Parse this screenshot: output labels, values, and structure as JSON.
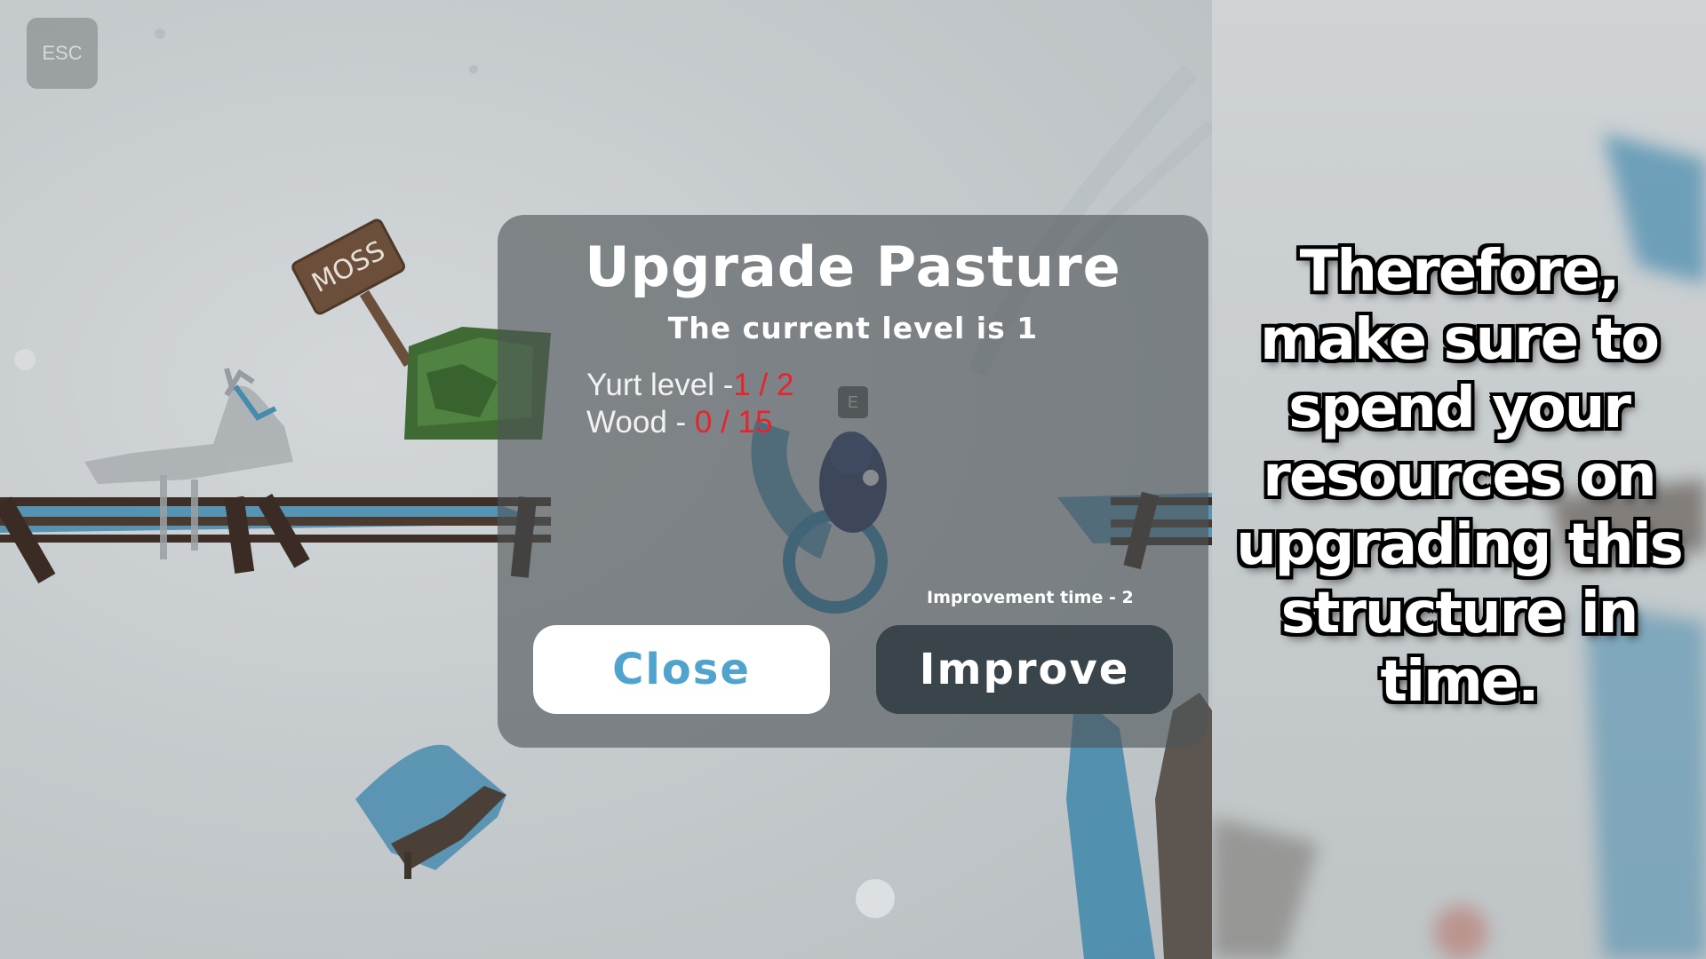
{
  "hud": {
    "esc_label": "ESC"
  },
  "world": {
    "sign_text": "MOSS",
    "interact_key": "E"
  },
  "dialog": {
    "title": "Upgrade Pasture",
    "current_level_text": "The current level is 1",
    "requirements": [
      {
        "label": "Yurt level -",
        "value": "1 / 2"
      },
      {
        "label": "Wood - ",
        "value": "0 / 15"
      }
    ],
    "improvement_time": "Improvement time - 2",
    "close_label": "Close",
    "improve_label": "Improve"
  },
  "caption": {
    "text": "Therefore, make sure to spend your resources on upgrading this structure in time."
  },
  "colors": {
    "unmet_requirement": "#e8232b",
    "close_text": "#4fa3cc",
    "improve_bg": "#3a444b",
    "shadow_blue": "#2f7fa8"
  }
}
